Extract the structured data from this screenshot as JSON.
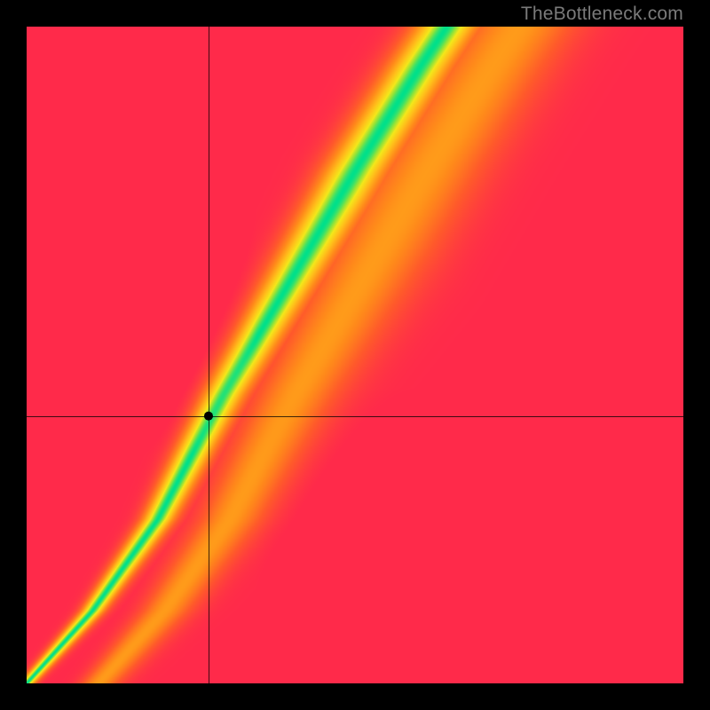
{
  "watermark": "TheBottleneck.com",
  "chart_data": {
    "type": "heatmap",
    "title": "",
    "xlabel": "",
    "ylabel": "",
    "x_range": [
      0,
      1
    ],
    "y_range": [
      0,
      1
    ],
    "crosshair": {
      "x": 0.277,
      "y": 0.407
    },
    "marker": {
      "x": 0.277,
      "y": 0.407
    },
    "optimal_band": {
      "description": "green ridge where GPU/CPU are balanced; slope ≈ 1.65 with slight S-curve",
      "center_line_points": [
        [
          0.0,
          0.0
        ],
        [
          0.1,
          0.11
        ],
        [
          0.2,
          0.25
        ],
        [
          0.3,
          0.44
        ],
        [
          0.4,
          0.61
        ],
        [
          0.5,
          0.78
        ],
        [
          0.6,
          0.94
        ],
        [
          0.64,
          1.0
        ]
      ],
      "half_width_normalized": 0.035
    },
    "color_stops": {
      "0.00": "#00e08a",
      "0.10": "#8ee33a",
      "0.20": "#f3e71a",
      "0.35": "#ffbf1a",
      "0.55": "#ff8a1a",
      "0.75": "#ff5a2a",
      "1.00": "#ff2a4a"
    }
  }
}
